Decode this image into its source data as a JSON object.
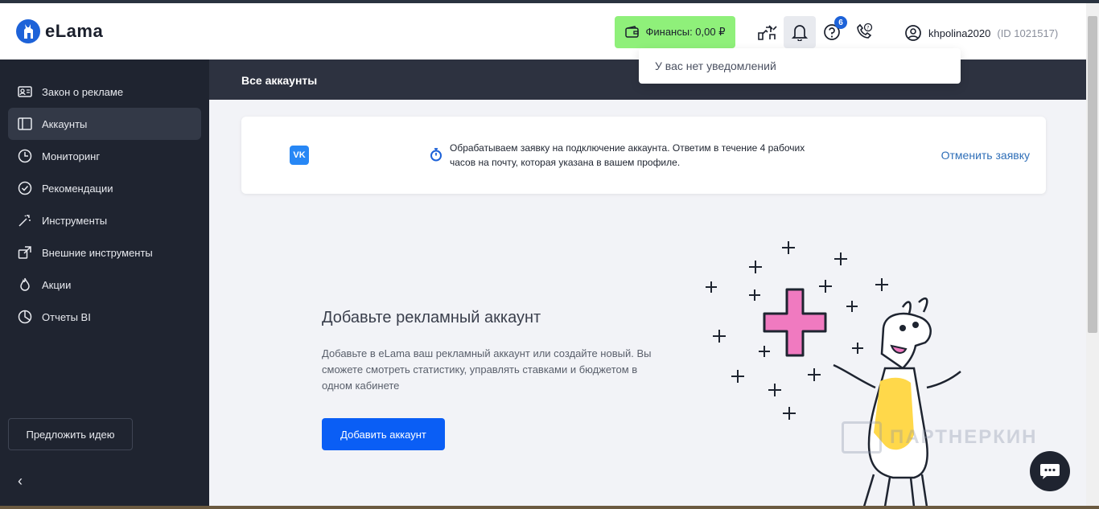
{
  "header": {
    "logo_text": "eLama",
    "finance_label": "Финансы: 0,00 ₽",
    "help_badge": "6",
    "username": "khpolina2020",
    "user_id": "(ID 1021517)"
  },
  "notifications": {
    "empty_text": "У вас нет уведомлений"
  },
  "sidebar": {
    "items": [
      {
        "label": "Закон о рекламе"
      },
      {
        "label": "Аккаунты"
      },
      {
        "label": "Мониторинг"
      },
      {
        "label": "Рекомендации"
      },
      {
        "label": "Инструменты"
      },
      {
        "label": "Внешние инструменты"
      },
      {
        "label": "Акции"
      },
      {
        "label": "Отчеты BI"
      }
    ],
    "idea_label": "Предложить идею",
    "collapse_glyph": "‹"
  },
  "page": {
    "title": "Все аккаунты"
  },
  "request_card": {
    "platform_glyph": "VK",
    "message": "Обрабатываем заявку на подключение аккаунта. Ответим в течение 4 рабочих часов на почту, которая указана в вашем профиле.",
    "cancel_label": "Отменить заявку"
  },
  "empty_state": {
    "title": "Добавьте рекламный аккаунт",
    "description": "Добавьте в eLama ваш рекламный аккаунт или создайте новый. Вы сможете смотреть статистику, управлять ставками и бюджетом в одном кабинете",
    "button_label": "Добавить аккаунт"
  },
  "watermark": {
    "text": "ПАРТНЕРКИН"
  },
  "colors": {
    "accent": "#0a5ef5",
    "finance_bg": "#8ff07a",
    "sidebar_bg": "#1f2430",
    "topbar_bg": "#2d3240"
  }
}
